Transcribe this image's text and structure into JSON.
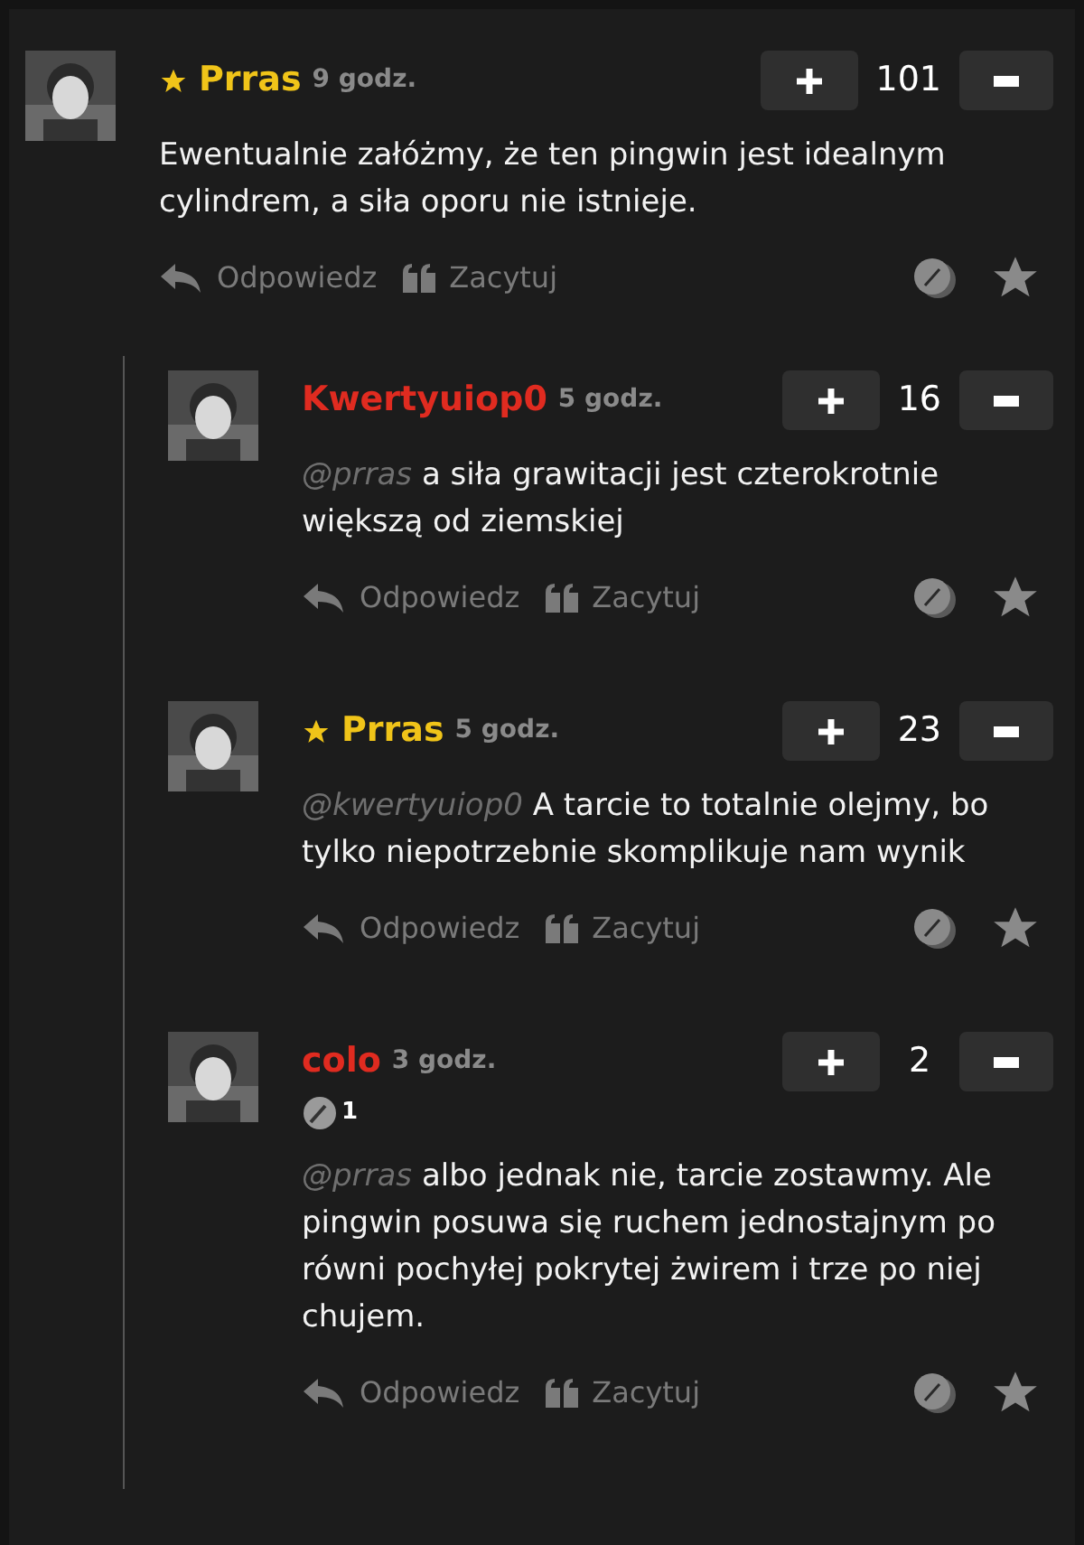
{
  "comments": [
    {
      "author": "Prras",
      "starred": true,
      "color": "#f0c419",
      "time": "9 godz.",
      "votes": "101",
      "text": "Ewentualnie załóżmy, że ten pingwin jest idealnym cylindrem, a siła oporu nie istnieje.",
      "actions": [
        "Odpowiedz",
        "Zacytuj"
      ],
      "children": [
        {
          "author": "Kwertyuiop0",
          "starred": false,
          "color": "#e02b20",
          "time": "5 godz.",
          "votes": "16",
          "mention": "@prras",
          "text": "a siła grawitacji jest czterokrotnie większą od ziemskiej",
          "actions": [
            "Odpowiedz",
            "Zacytuj"
          ]
        },
        {
          "author": "Prras",
          "starred": true,
          "color": "#f0c419",
          "time": "5 godz.",
          "votes": "23",
          "mention": "@kwertyuiop0",
          "text": "A tarcie to totalnie olejmy, bo tylko niepotrzebnie skomplikuje nam wynik",
          "actions": [
            "Odpowiedz",
            "Zacytuj"
          ]
        },
        {
          "author": "colo",
          "starred": false,
          "color": "#e02b20",
          "time": "3 godz.",
          "votes": "2",
          "badge": "1",
          "mention": "@prras",
          "text": "albo jednak nie, tarcie zostawmy. Ale pingwin posuwa się ruchem jednostajnym po równi pochyłej pokrytej żwirem i trze po niej chujem.",
          "actions": [
            "Odpowiedz",
            "Zacytuj"
          ]
        }
      ]
    }
  ]
}
